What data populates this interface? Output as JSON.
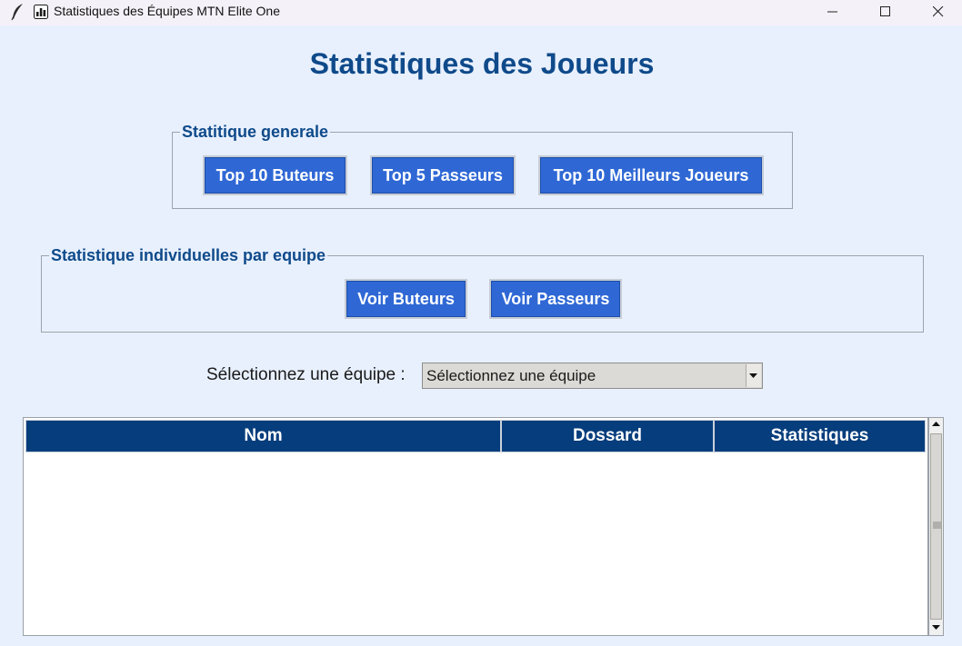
{
  "window": {
    "title": "Statistiques des Équipes MTN Elite One"
  },
  "page": {
    "title": "Statistiques des Joueurs"
  },
  "general_stats": {
    "legend": "Statitique generale",
    "buttons": [
      "Top 10 Buteurs",
      "Top 5 Passeurs",
      "Top 10 Meilleurs Joueurs"
    ]
  },
  "team_stats": {
    "legend": "Statistique individuelles par equipe",
    "buttons": [
      "Voir Buteurs",
      "Voir Passeurs"
    ]
  },
  "team_select": {
    "label": "Sélectionnez une équipe :",
    "value": "Sélectionnez une équipe"
  },
  "table": {
    "columns": [
      "Nom",
      "Dossard",
      "Statistiques"
    ],
    "rows": []
  },
  "colors": {
    "background": "#e8f0fe",
    "accent": "#0f4a8a",
    "button": "#2f68d5",
    "table_header": "#063d7c"
  },
  "icons": {
    "title_bar": [
      "feather-icon",
      "bar-chart-icon"
    ],
    "window_controls": [
      "minimize-icon",
      "maximize-icon",
      "close-icon"
    ]
  }
}
